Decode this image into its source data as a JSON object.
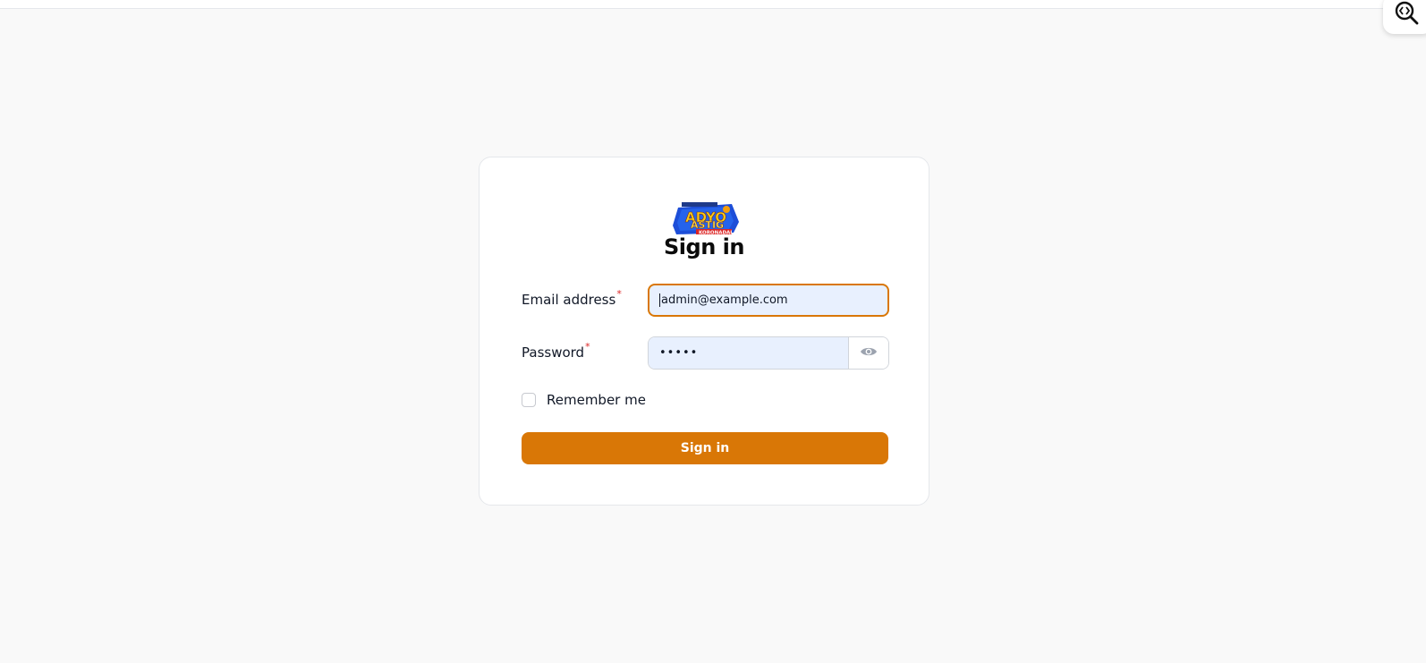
{
  "page": {
    "title": "Sign in",
    "accent_color": "#d97706"
  },
  "logo": {
    "name": "radyo-astig-koronadal-logo",
    "text_main": "RADYO ASTIG",
    "text_sub": "KORONADAL"
  },
  "form": {
    "email_label": "Email address",
    "email_value": "admin@example.com",
    "password_label": "Password",
    "password_value": "•••••",
    "required_mark": "*",
    "remember_label": "Remember me",
    "remember_checked": false,
    "submit_label": "Sign in"
  },
  "icons": {
    "password_toggle": "eye-icon",
    "corner_widget": "code-search-icon"
  }
}
